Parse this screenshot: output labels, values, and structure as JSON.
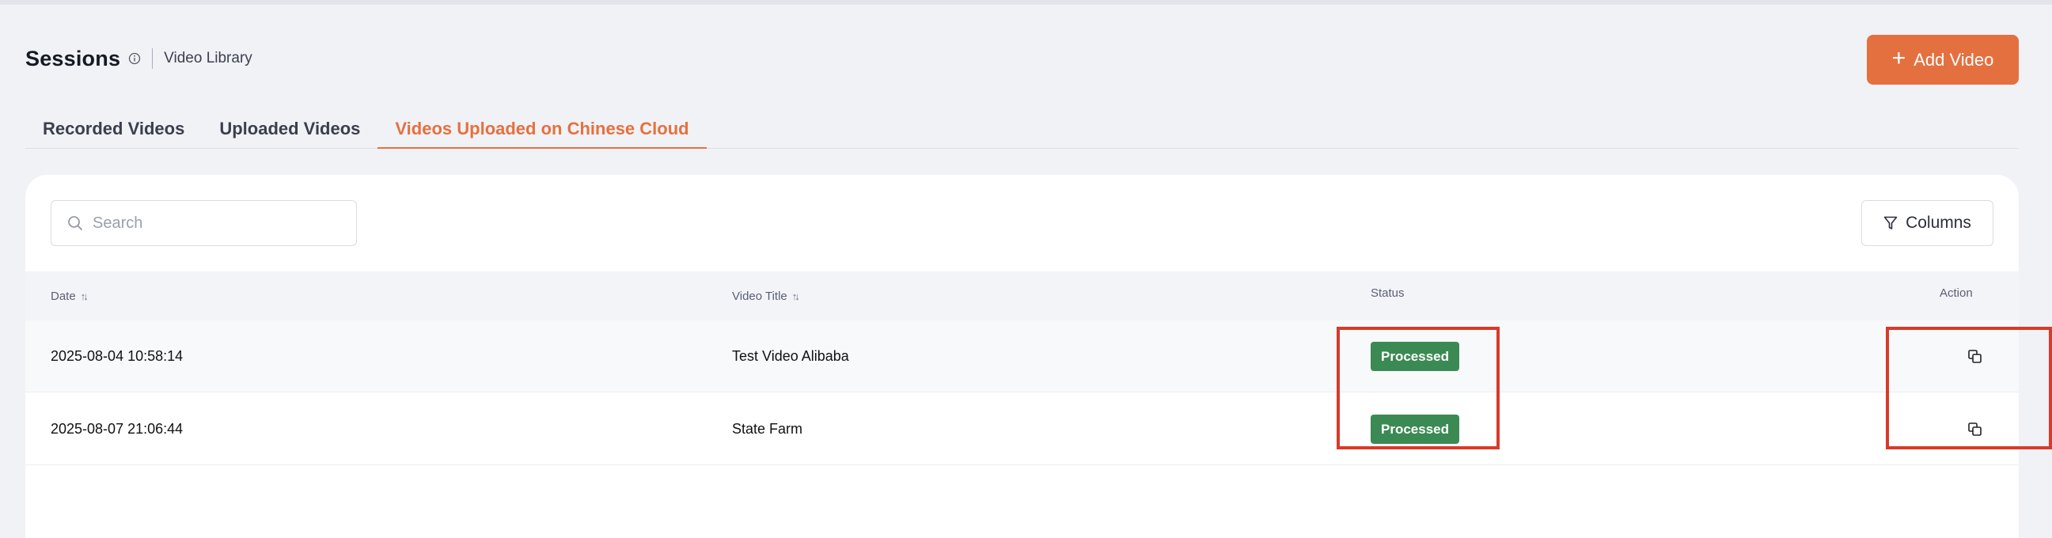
{
  "header": {
    "title": "Sessions",
    "breadcrumb": "Video Library",
    "add_button": "Add Video",
    "add_icon": "+"
  },
  "tabs": [
    {
      "label": "Recorded Videos",
      "active": false
    },
    {
      "label": "Uploaded Videos",
      "active": false
    },
    {
      "label": "Videos Uploaded on Chinese Cloud",
      "active": true
    }
  ],
  "toolbar": {
    "search_placeholder": "Search",
    "columns_label": "Columns"
  },
  "table": {
    "columns": [
      "Date",
      "Video Title",
      "Status",
      "Action"
    ],
    "sort_glyph": "↑↓",
    "rows": [
      {
        "date": "2025-08-04 10:58:14",
        "title": "Test Video Alibaba",
        "status": "Processed"
      },
      {
        "date": "2025-08-07 21:06:44",
        "title": "State Farm",
        "status": "Processed"
      }
    ]
  },
  "colors": {
    "accent": "#e5703f",
    "status_processed": "#3b8a53",
    "highlight": "#d93a2b"
  },
  "icons": [
    "info-icon",
    "plus-icon",
    "search-icon",
    "filter-icon",
    "copy-icon"
  ]
}
